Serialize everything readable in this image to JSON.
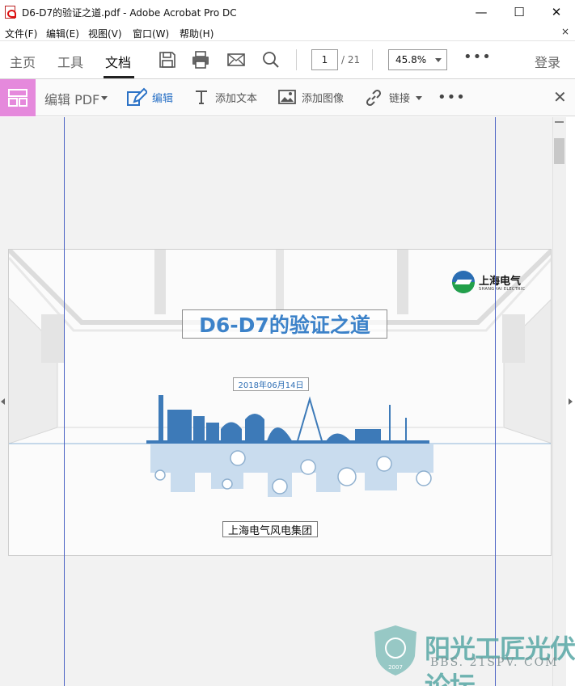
{
  "window": {
    "title": "D6-D7的验证之道.pdf - Adobe Acrobat Pro DC",
    "minimize": "—",
    "maximize": "☐",
    "close": "✕"
  },
  "menu": {
    "items": [
      "文件(F)",
      "编辑(E)",
      "视图(V)",
      "窗口(W)",
      "帮助(H)"
    ],
    "close": "×"
  },
  "toolbar": {
    "tabs": [
      "主页",
      "工具",
      "文档"
    ],
    "active_tab": "文档",
    "icons": [
      "save-icon",
      "print-icon",
      "email-icon",
      "search-icon"
    ],
    "page_current": "1",
    "page_total": "/ 21",
    "zoom": "45.8%",
    "more": "•••",
    "login": "登录"
  },
  "edit_toolbar": {
    "mode_label": "编辑 PDF",
    "edit": "编辑",
    "add_text": "添加文本",
    "add_image": "添加图像",
    "link": "链接",
    "more": "•••",
    "close": "✕"
  },
  "slide": {
    "title": "D6-D7的验证之道",
    "date": "2018年06月14日",
    "company": "上海电气风电集团",
    "logo_cn": "上海电气",
    "logo_en": "SHANGHAI ELECTRIC"
  },
  "watermark": {
    "text": "阳光工匠光伏论坛",
    "url": "BBS. 21SPV. COM",
    "year": "2007"
  },
  "colors": {
    "accent_blue": "#2b72c6",
    "edit_tile": "#e589dc",
    "slide_title": "#3c82c9",
    "guide_line": "#4a62c4",
    "watermark": "#58a7a5"
  }
}
